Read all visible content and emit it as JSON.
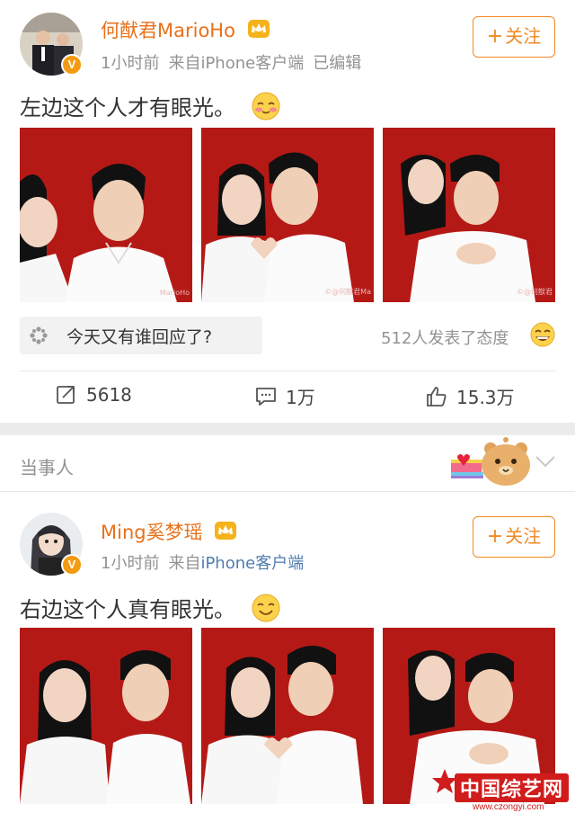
{
  "post1": {
    "username": "何猷君MarioHo",
    "time": "1小时前",
    "source_prefix": "来自",
    "source": "iPhone客户端",
    "edited": "已编辑",
    "follow_label": "关注",
    "text": "左边这个人才有眼光。",
    "photo_watermarks": [
      "MarioHo",
      "©@何猷君Ma",
      "©@何猷君"
    ],
    "topic": "今天又有谁回应了?",
    "attitude": "512人发表了态度",
    "actions": {
      "repost": "5618",
      "comment": "1万",
      "like": "15.3万"
    }
  },
  "section_label": "当事人",
  "post2": {
    "username": "Ming奚梦瑶",
    "time": "1小时前",
    "source_prefix": "来自",
    "source": "iPhone客户端",
    "follow_label": "关注",
    "text": "右边这个人真有眼光。"
  },
  "verified_badge": "V",
  "watermark": {
    "brand": "中国综艺网",
    "url": "www.czongyi.com"
  },
  "colors": {
    "username": "#e8711a",
    "follow": "#f08a24",
    "link": "#507daf",
    "meta": "#939393",
    "photo_bg": "#b51916"
  },
  "icons": [
    "crown-icon",
    "blush-emoji-icon",
    "smile-emoji-icon",
    "grin-emoji-icon",
    "topic-pinwheel-icon",
    "repost-icon",
    "comment-icon",
    "like-icon",
    "bear-sticker-icon",
    "chevron-down-icon"
  ]
}
